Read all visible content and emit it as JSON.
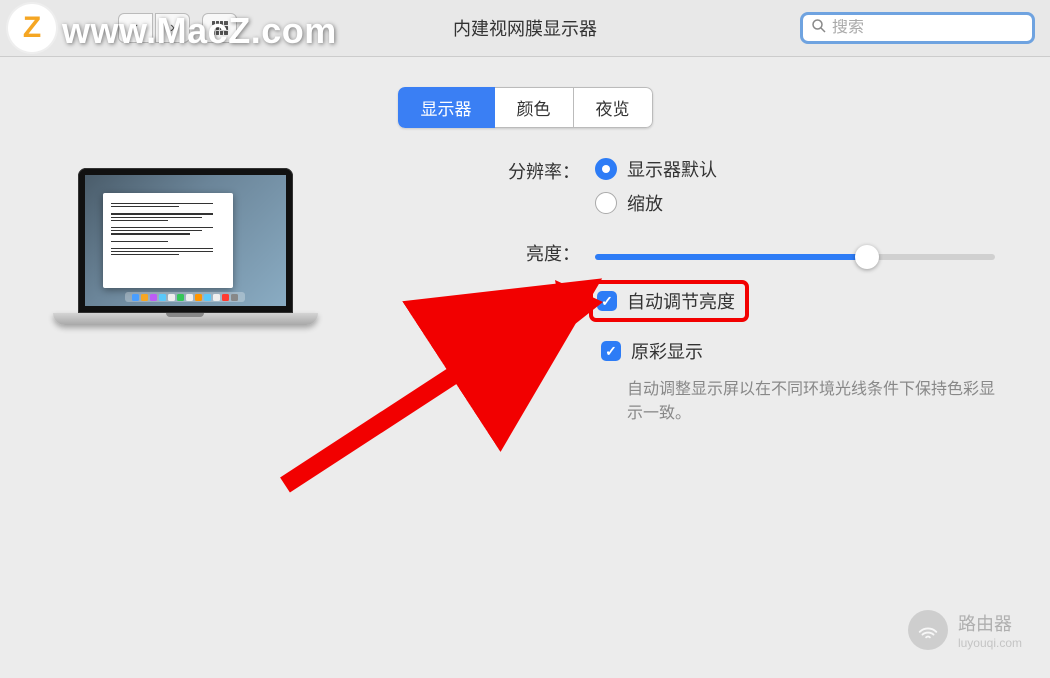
{
  "toolbar": {
    "title": "内建视网膜显示器",
    "search_placeholder": "搜索"
  },
  "tabs": [
    {
      "label": "显示器",
      "active": true
    },
    {
      "label": "颜色",
      "active": false
    },
    {
      "label": "夜览",
      "active": false
    }
  ],
  "settings": {
    "resolution": {
      "label": "分辨率：",
      "options": [
        {
          "label": "显示器默认",
          "checked": true
        },
        {
          "label": "缩放",
          "checked": false
        }
      ]
    },
    "brightness": {
      "label": "亮度：",
      "value_percent": 68
    },
    "auto_brightness": {
      "label": "自动调节亮度",
      "checked": true
    },
    "true_tone": {
      "label": "原彩显示",
      "checked": true,
      "description": "自动调整显示屏以在不同环境光线条件下保持色彩显示一致。"
    }
  },
  "watermark": {
    "logo": "Z",
    "text": "www.MacZ.com",
    "router_label": "路由器",
    "router_sub": "luyouqi.com"
  },
  "colors": {
    "accent": "#2d7cf6",
    "highlight_border": "#f20000",
    "arrow": "#f20000"
  }
}
